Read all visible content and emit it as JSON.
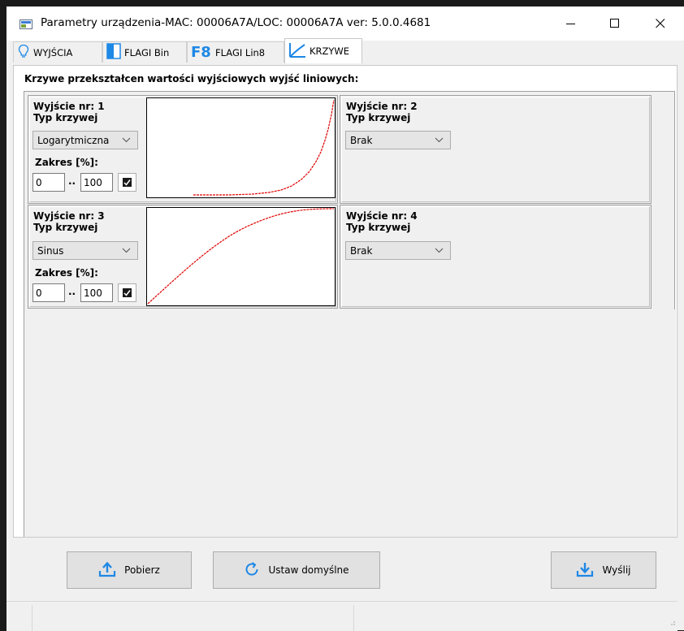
{
  "window": {
    "title": "Parametry urządzenia-MAC: 00006A7A/LOC: 00006A7A ver: 5.0.0.4681"
  },
  "tabs": [
    {
      "label": "WYJŚCIA",
      "icon": "bulb-icon"
    },
    {
      "label": "FLAGI Bin",
      "icon": "half-square-icon"
    },
    {
      "label": "FLAGI Lin8",
      "icon": "f8-icon"
    },
    {
      "label": "KRZYWE",
      "icon": "curve-icon",
      "active": true
    }
  ],
  "panel": {
    "heading": "Krzywe przekształcen wartości wyjściowych wyjść liniowych:"
  },
  "outputs": [
    {
      "title": "Wyjście nr: 1",
      "curve_label": "Typ krzywej",
      "curve_type": "Logarytmiczna",
      "range_label": "Zakres [%]:",
      "range_from": "0",
      "range_sep": "..",
      "range_to": "100",
      "curve_color": "#e00000"
    },
    {
      "title": "Wyjście nr: 2",
      "curve_label": "Typ krzywej",
      "curve_type": "Brak"
    },
    {
      "title": "Wyjście nr: 3",
      "curve_label": "Typ krzywej",
      "curve_type": "Sinus",
      "range_label": "Zakres [%]:",
      "range_from": "0",
      "range_sep": "..",
      "range_to": "100",
      "curve_color": "#e00000"
    },
    {
      "title": "Wyjście nr: 4",
      "curve_label": "Typ krzywej",
      "curve_type": "Brak"
    }
  ],
  "buttons": {
    "download": "Pobierz",
    "defaults": "Ustaw domyślne",
    "send": "Wyślij"
  },
  "colors": {
    "accent": "#1e88e5",
    "curve": "#e00000"
  }
}
